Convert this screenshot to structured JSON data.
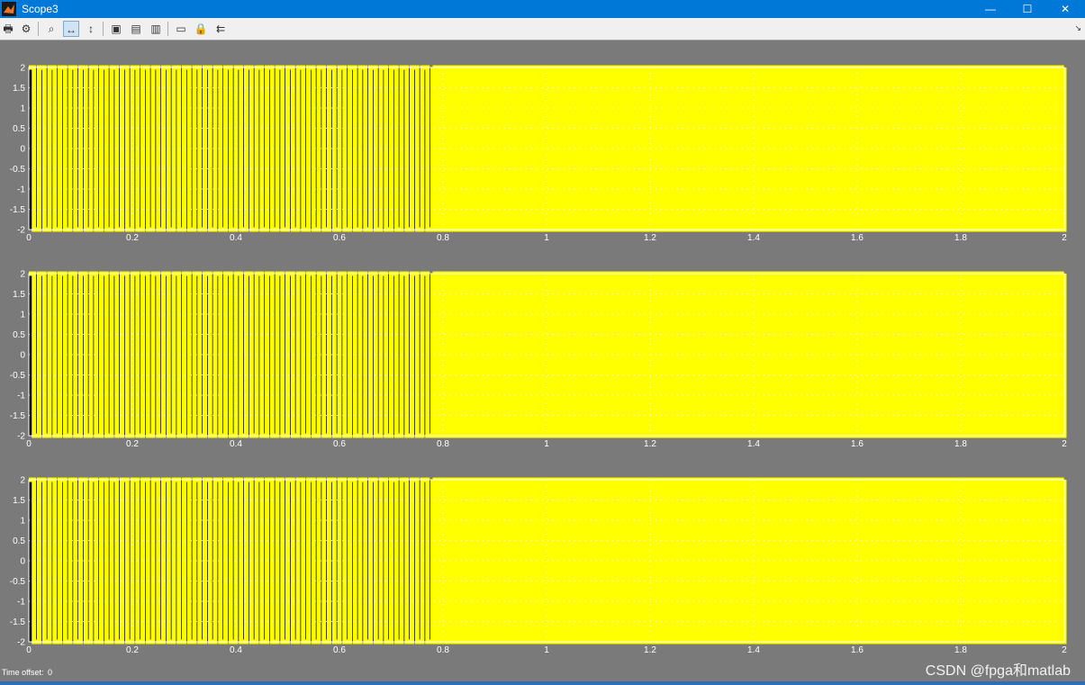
{
  "window": {
    "title": "Scope3",
    "minimize_glyph": "—",
    "maximize_glyph": "☐",
    "close_glyph": "✕"
  },
  "toolbar": {
    "buttons": [
      {
        "name": "print-button",
        "icon": "printer-icon",
        "glyph": "🖶",
        "active": false
      },
      {
        "name": "parameters-button",
        "icon": "gear-icon",
        "glyph": "⚙",
        "active": false
      },
      {
        "name": "zoom-button",
        "icon": "magnifier-icon",
        "glyph": "⌕",
        "active": false
      },
      {
        "name": "zoom-x-button",
        "icon": "zoom-x-icon",
        "glyph": "↔",
        "active": true
      },
      {
        "name": "zoom-y-button",
        "icon": "zoom-y-icon",
        "glyph": "↕",
        "active": false
      },
      {
        "name": "autoscale-button",
        "icon": "autoscale-icon",
        "glyph": "▣",
        "active": false
      },
      {
        "name": "save-axes-button",
        "icon": "save-axes-icon",
        "glyph": "▤",
        "active": false
      },
      {
        "name": "restore-axes-button",
        "icon": "restore-axes-icon",
        "glyph": "▥",
        "active": false
      },
      {
        "name": "floating-scope-button",
        "icon": "floating-scope-icon",
        "glyph": "▭",
        "active": false
      },
      {
        "name": "lock-axes-button",
        "icon": "lock-icon",
        "glyph": "🔒",
        "active": false
      },
      {
        "name": "signal-selection-button",
        "icon": "signal-selection-icon",
        "glyph": "⇇",
        "active": false
      }
    ],
    "corner_glyph": "↘"
  },
  "colors": {
    "background": "#7a7a7a",
    "axes_background": "#000000",
    "trace": "#ffff00",
    "tick_label": "#ffffff",
    "grid": "#ffffff"
  },
  "chart_data": [
    {
      "type": "line",
      "xlim": [
        0,
        2
      ],
      "ylim": [
        -2,
        2
      ],
      "xticks": [
        "0",
        "0.2",
        "0.4",
        "0.6",
        "0.8",
        "1",
        "1.2",
        "1.4",
        "1.6",
        "1.8",
        "2"
      ],
      "yticks": [
        "2",
        "1.5",
        "1",
        "0.5",
        "0",
        "-0.5",
        "-1",
        "-1.5",
        "-2"
      ],
      "grid": true,
      "series": [
        {
          "segments": [
            {
              "x_start": 0,
              "x_end": 0.78,
              "frequency_hz": 50
            },
            {
              "x_start": 0.78,
              "x_end": 2,
              "frequency_hz": 100
            }
          ],
          "amplitude": 2
        }
      ]
    },
    {
      "type": "line",
      "xlim": [
        0,
        2
      ],
      "ylim": [
        -2,
        2
      ],
      "xticks": [
        "0",
        "0.2",
        "0.4",
        "0.6",
        "0.8",
        "1",
        "1.2",
        "1.4",
        "1.6",
        "1.8",
        "2"
      ],
      "yticks": [
        "2",
        "1.5",
        "1",
        "0.5",
        "0",
        "-0.5",
        "-1",
        "-1.5",
        "-2"
      ],
      "grid": true,
      "series": [
        {
          "segments": [
            {
              "x_start": 0,
              "x_end": 0.78,
              "frequency_hz": 50
            },
            {
              "x_start": 0.78,
              "x_end": 2,
              "frequency_hz": 100
            }
          ],
          "amplitude": 2
        }
      ]
    },
    {
      "type": "line",
      "xlim": [
        0,
        2
      ],
      "ylim": [
        -2,
        2
      ],
      "xticks": [
        "0",
        "0.2",
        "0.4",
        "0.6",
        "0.8",
        "1",
        "1.2",
        "1.4",
        "1.6",
        "1.8",
        "2"
      ],
      "yticks": [
        "2",
        "1.5",
        "1",
        "0.5",
        "0",
        "-0.5",
        "-1",
        "-1.5",
        "-2"
      ],
      "grid": true,
      "series": [
        {
          "segments": [
            {
              "x_start": 0,
              "x_end": 0.78,
              "frequency_hz": 50
            },
            {
              "x_start": 0.78,
              "x_end": 2,
              "frequency_hz": 100
            }
          ],
          "amplitude": 2
        }
      ]
    }
  ],
  "footer": {
    "time_offset_label": "Time offset:",
    "time_offset_value": "0",
    "watermark": "CSDN @fpga和matlab"
  }
}
